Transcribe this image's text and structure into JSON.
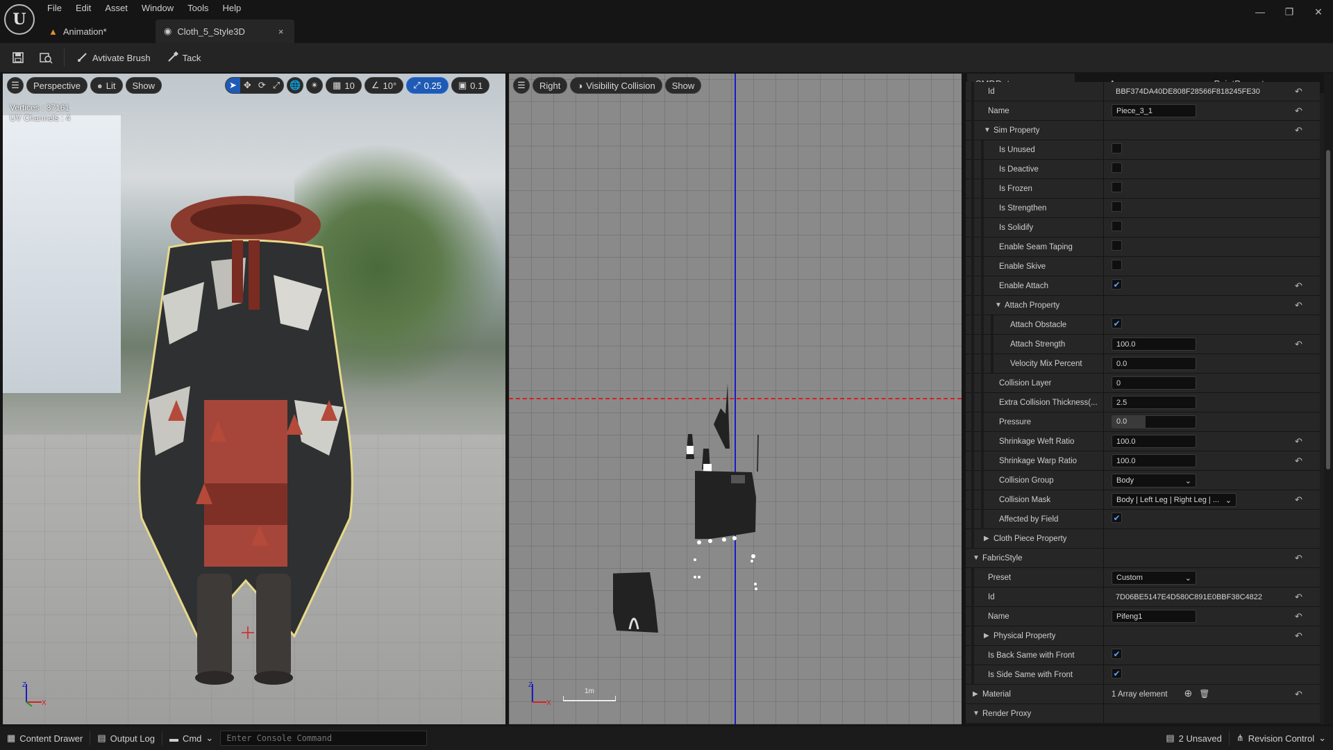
{
  "menu": [
    "File",
    "Edit",
    "Asset",
    "Window",
    "Tools",
    "Help"
  ],
  "tabs": [
    {
      "label": "Animation*"
    },
    {
      "label": "Cloth_5_Style3D",
      "close": "×"
    }
  ],
  "toolbar": {
    "brush_label": "Avtivate Brush",
    "tack_label": "Tack"
  },
  "vp1": {
    "mode": "Perspective",
    "lighting": "Lit",
    "show": "Show",
    "grid_snap": "10",
    "angle_snap": "10°",
    "scale_snap": "0.25",
    "camera_speed": "0.1",
    "stats": {
      "vertices": "Vertices : 37161",
      "uv": "UV Channels : 4"
    }
  },
  "vp2": {
    "view": "Right",
    "vis": "Visibility Collision",
    "show": "Show",
    "scale": "1m"
  },
  "panel": {
    "tabs": [
      {
        "label": "SMDData",
        "close": "×"
      },
      {
        "label": "Accessory"
      },
      {
        "label": "PaintProperty"
      }
    ],
    "rows": [
      {
        "label": "Id",
        "value": "BBF374DA40DE808F28566F818245FE30"
      },
      {
        "label": "Name",
        "value": "Piece_3_1"
      },
      {
        "label": "Sim Property"
      },
      {
        "label": "Is Unused"
      },
      {
        "label": "Is Deactive"
      },
      {
        "label": "Is Frozen"
      },
      {
        "label": "Is Strengthen"
      },
      {
        "label": "Is Solidify"
      },
      {
        "label": "Enable Seam Taping"
      },
      {
        "label": "Enable Skive"
      },
      {
        "label": "Enable Attach"
      },
      {
        "label": "Attach Property"
      },
      {
        "label": "Attach Obstacle"
      },
      {
        "label": "Attach Strength",
        "value": "100.0"
      },
      {
        "label": "Velocity Mix Percent",
        "value": "0.0"
      },
      {
        "label": "Collision Layer",
        "value": "0"
      },
      {
        "label": "Extra Collision Thickness(...",
        "value": "2.5"
      },
      {
        "label": "Pressure",
        "value": "0.0"
      },
      {
        "label": "Shrinkage Weft Ratio",
        "value": "100.0"
      },
      {
        "label": "Shrinkage Warp Ratio",
        "value": "100.0"
      },
      {
        "label": "Collision Group",
        "value": "Body"
      },
      {
        "label": "Collision Mask",
        "value": "Body | Left Leg | Right Leg | ..."
      },
      {
        "label": "Affected by Field"
      },
      {
        "label": "Cloth Piece Property"
      },
      {
        "label": "FabricStyle"
      },
      {
        "label": "Preset",
        "value": "Custom"
      },
      {
        "label": "Id",
        "value": "7D06BE5147E4D580C891E0BBF38C4822"
      },
      {
        "label": "Name",
        "value": "Pifeng1"
      },
      {
        "label": "Physical Property"
      },
      {
        "label": "Is Back Same with Front"
      },
      {
        "label": "Is Side Same with Front"
      },
      {
        "label": "Material",
        "value": "1 Array element"
      },
      {
        "label": "Render Proxy"
      }
    ]
  },
  "status": {
    "content_drawer": "Content Drawer",
    "output_log": "Output Log",
    "cmd": "Cmd",
    "console_placeholder": "Enter Console Command",
    "unsaved": "2 Unsaved",
    "revision": "Revision Control"
  },
  "colors": {
    "accent": "#1f5bb5",
    "check": "#4ea6ff",
    "axis_x": "#d62020",
    "axis_z": "#1a1ac8"
  }
}
